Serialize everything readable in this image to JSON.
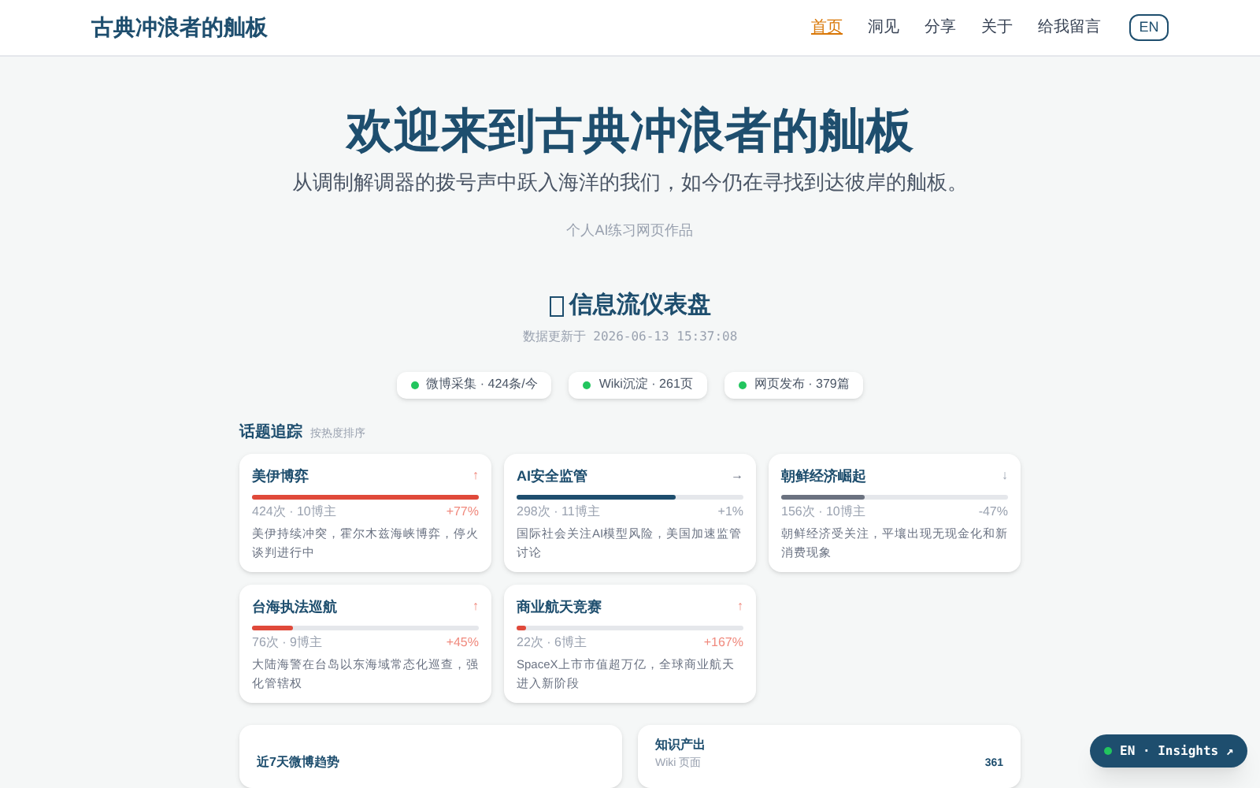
{
  "header": {
    "logo": "古典冲浪者的舢板",
    "nav": [
      {
        "label": "首页",
        "selected": true
      },
      {
        "label": "洞见",
        "selected": false
      },
      {
        "label": "分享",
        "selected": false
      },
      {
        "label": "关于",
        "selected": false
      },
      {
        "label": "给我留言",
        "selected": false
      }
    ],
    "lang_button": "EN"
  },
  "hero": {
    "title": "欢迎来到古典冲浪者的舢板",
    "subtitle": "从调制解调器的拨号声中跃入海洋的我们，如今仍在寻找到达彼岸的舢板。",
    "note": "个人AI练习网页作品"
  },
  "dashboard": {
    "title": "信息流仪表盘",
    "updated": "数据更新于 2026-06-13 15:37:08",
    "sources": [
      {
        "label": "微博采集 · 424条/今",
        "color": "#22c55e"
      },
      {
        "label": "Wiki沉淀 · 261页",
        "color": "#22c55e"
      },
      {
        "label": "网页发布 · 379篇",
        "color": "#22c55e"
      }
    ],
    "topics_title": "话题追踪",
    "topics_hint": "按热度排序",
    "topics": [
      {
        "name": "美伊博弈",
        "kind": "up",
        "arrow": "↑",
        "level": 1.0,
        "stats": "424次 · 10博主",
        "change": "+77%",
        "summary": "美伊持续冲突，霍尔木兹海峡博弈，停火谈判进行中"
      },
      {
        "name": "AI安全监管",
        "kind": "flat",
        "arrow": "→",
        "level": 0.7,
        "stats": "298次 · 11博主",
        "change": "+1%",
        "summary": "国际社会关注AI模型风险，美国加速监管讨论"
      },
      {
        "name": "朝鲜经济崛起",
        "kind": "down",
        "arrow": "↓",
        "level": 0.37,
        "stats": "156次 · 10博主",
        "change": "-47%",
        "summary": "朝鲜经济受关注，平壤出现无现金化和新消费现象"
      },
      {
        "name": "台海执法巡航",
        "kind": "up",
        "arrow": "↑",
        "level": 0.18,
        "stats": "76次 · 9博主",
        "change": "+45%",
        "summary": "大陆海警在台岛以东海域常态化巡查，强化管辖权"
      },
      {
        "name": "商业航天竞赛",
        "kind": "up",
        "arrow": "↑",
        "level": 0.04,
        "stats": "22次 · 6博主",
        "change": "+167%",
        "summary": "SpaceX上市市值超万亿，全球商业航天进入新阶段"
      }
    ],
    "weibo_trend": {
      "title": "近7天微博趋势"
    },
    "knowledge": {
      "title": "知识产出",
      "rows": [
        {
          "label": "Wiki 页面",
          "value": "361"
        }
      ]
    }
  },
  "insights_button": {
    "label": "EN · Insights ↗",
    "color": "#22c55e"
  }
}
